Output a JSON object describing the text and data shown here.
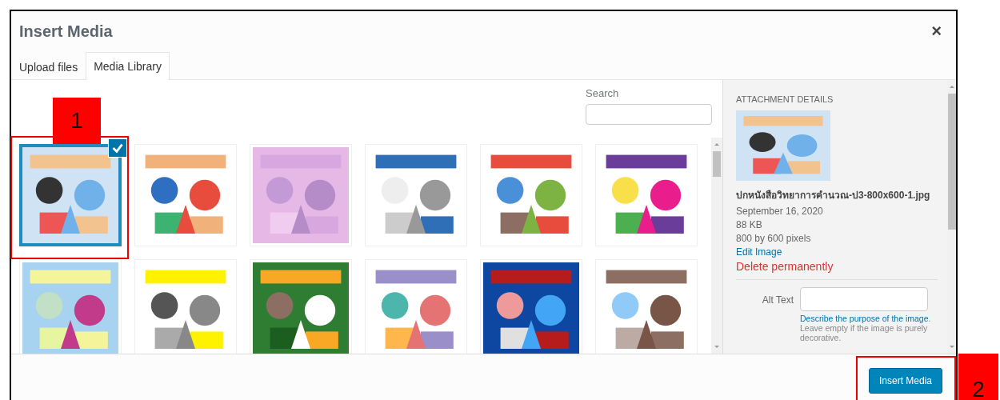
{
  "window": {
    "title": "Insert Media",
    "close": "×"
  },
  "tabs": [
    {
      "label": "Upload files",
      "selected": false
    },
    {
      "label": "Media Library",
      "selected": true
    }
  ],
  "search": {
    "label": "Search"
  },
  "media_items": [
    {
      "kind": "picture",
      "selected": true,
      "callout": "1"
    },
    {
      "kind": "picture",
      "selected": false
    },
    {
      "kind": "picture",
      "selected": false
    },
    {
      "kind": "picture",
      "selected": false
    },
    {
      "kind": "picture",
      "selected": false
    },
    {
      "kind": "picture",
      "selected": false
    },
    {
      "kind": "picture",
      "selected": false
    },
    {
      "kind": "picture",
      "selected": false
    },
    {
      "kind": "picture",
      "selected": false
    },
    {
      "kind": "picture",
      "selected": false
    },
    {
      "kind": "picture",
      "selected": false
    },
    {
      "kind": "picture",
      "selected": false
    }
  ],
  "attachment_details": {
    "heading": "ATTACHMENT DETAILS",
    "filename": "ปกหนังสือวิทยาการคำนวณ-ป3-800x600-1.jpg",
    "date": "September 16, 2020",
    "size": "88 KB",
    "dimensions": "800 by 600 pixels",
    "edit_link": "Edit Image",
    "delete_link": "Delete permanently",
    "alt_text_label": "Alt Text",
    "alt_help_link": "Describe the purpose of the image",
    "alt_help_text": ". Leave empty if the image is purely decorative."
  },
  "footer": {
    "button": "Insert Media",
    "callout": "2"
  }
}
